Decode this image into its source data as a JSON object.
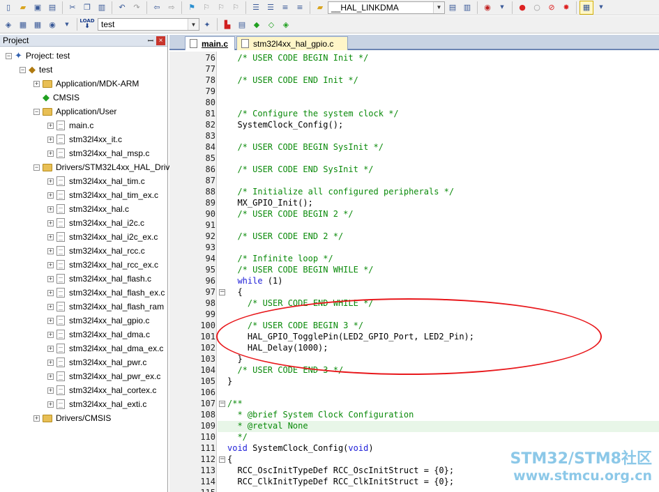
{
  "toolbar1": {
    "target_combo": "__HAL_LINKDMA"
  },
  "toolbar2": {
    "load_label": "LOAD",
    "target_select": "test"
  },
  "project_panel": {
    "title": "Project",
    "pin": "ꟷ",
    "close": "×",
    "tree": [
      {
        "label": "Project: test",
        "depth": 0,
        "kind": "project",
        "expander": "−"
      },
      {
        "label": "test",
        "depth": 1,
        "kind": "target",
        "expander": "−"
      },
      {
        "label": "Application/MDK-ARM",
        "depth": 2,
        "kind": "folder",
        "expander": "+"
      },
      {
        "label": "CMSIS",
        "depth": 2,
        "kind": "gem",
        "expander": ""
      },
      {
        "label": "Application/User",
        "depth": 2,
        "kind": "folder",
        "expander": "−"
      },
      {
        "label": "main.c",
        "depth": 3,
        "kind": "file",
        "expander": "+"
      },
      {
        "label": "stm32l4xx_it.c",
        "depth": 3,
        "kind": "file",
        "expander": "+"
      },
      {
        "label": "stm32l4xx_hal_msp.c",
        "depth": 3,
        "kind": "file",
        "expander": "+"
      },
      {
        "label": "Drivers/STM32L4xx_HAL_Driv",
        "depth": 2,
        "kind": "folder",
        "expander": "−"
      },
      {
        "label": "stm32l4xx_hal_tim.c",
        "depth": 3,
        "kind": "file",
        "expander": "+"
      },
      {
        "label": "stm32l4xx_hal_tim_ex.c",
        "depth": 3,
        "kind": "file",
        "expander": "+"
      },
      {
        "label": "stm32l4xx_hal.c",
        "depth": 3,
        "kind": "file",
        "expander": "+"
      },
      {
        "label": "stm32l4xx_hal_i2c.c",
        "depth": 3,
        "kind": "file",
        "expander": "+"
      },
      {
        "label": "stm32l4xx_hal_i2c_ex.c",
        "depth": 3,
        "kind": "file",
        "expander": "+"
      },
      {
        "label": "stm32l4xx_hal_rcc.c",
        "depth": 3,
        "kind": "file",
        "expander": "+"
      },
      {
        "label": "stm32l4xx_hal_rcc_ex.c",
        "depth": 3,
        "kind": "file",
        "expander": "+"
      },
      {
        "label": "stm32l4xx_hal_flash.c",
        "depth": 3,
        "kind": "file",
        "expander": "+"
      },
      {
        "label": "stm32l4xx_hal_flash_ex.c",
        "depth": 3,
        "kind": "file",
        "expander": "+"
      },
      {
        "label": "stm32l4xx_hal_flash_ram",
        "depth": 3,
        "kind": "file",
        "expander": "+"
      },
      {
        "label": "stm32l4xx_hal_gpio.c",
        "depth": 3,
        "kind": "file",
        "expander": "+"
      },
      {
        "label": "stm32l4xx_hal_dma.c",
        "depth": 3,
        "kind": "file",
        "expander": "+"
      },
      {
        "label": "stm32l4xx_hal_dma_ex.c",
        "depth": 3,
        "kind": "file",
        "expander": "+"
      },
      {
        "label": "stm32l4xx_hal_pwr.c",
        "depth": 3,
        "kind": "file",
        "expander": "+"
      },
      {
        "label": "stm32l4xx_hal_pwr_ex.c",
        "depth": 3,
        "kind": "file",
        "expander": "+"
      },
      {
        "label": "stm32l4xx_hal_cortex.c",
        "depth": 3,
        "kind": "file",
        "expander": "+"
      },
      {
        "label": "stm32l4xx_hal_exti.c",
        "depth": 3,
        "kind": "file",
        "expander": "+"
      },
      {
        "label": "Drivers/CMSIS",
        "depth": 2,
        "kind": "folder",
        "expander": "+"
      }
    ]
  },
  "tabs": [
    {
      "label": "main.c",
      "active": true
    },
    {
      "label": "stm32l4xx_hal_gpio.c",
      "active": false
    }
  ],
  "editor": {
    "highlighted_line": 109,
    "lines": [
      {
        "n": "76",
        "fold": "",
        "parts": [
          {
            "t": "  /* USER CODE BEGIN Init */",
            "c": "comment"
          }
        ]
      },
      {
        "n": "77",
        "fold": "",
        "parts": []
      },
      {
        "n": "78",
        "fold": "",
        "parts": [
          {
            "t": "  /* USER CODE END Init */",
            "c": "comment"
          }
        ]
      },
      {
        "n": "79",
        "fold": "",
        "parts": []
      },
      {
        "n": "80",
        "fold": "",
        "parts": []
      },
      {
        "n": "81",
        "fold": "",
        "parts": [
          {
            "t": "  /* Configure the system clock */",
            "c": "comment"
          }
        ]
      },
      {
        "n": "82",
        "fold": "",
        "parts": [
          {
            "t": "  SystemClock_Config();",
            "c": "code"
          }
        ]
      },
      {
        "n": "83",
        "fold": "",
        "parts": []
      },
      {
        "n": "84",
        "fold": "",
        "parts": [
          {
            "t": "  /* USER CODE BEGIN SysInit */",
            "c": "comment"
          }
        ]
      },
      {
        "n": "85",
        "fold": "",
        "parts": []
      },
      {
        "n": "86",
        "fold": "",
        "parts": [
          {
            "t": "  /* USER CODE END SysInit */",
            "c": "comment"
          }
        ]
      },
      {
        "n": "87",
        "fold": "",
        "parts": []
      },
      {
        "n": "88",
        "fold": "",
        "parts": [
          {
            "t": "  /* Initialize all configured peripherals */",
            "c": "comment"
          }
        ]
      },
      {
        "n": "89",
        "fold": "",
        "parts": [
          {
            "t": "  MX_GPIO_Init();",
            "c": "code"
          }
        ]
      },
      {
        "n": "90",
        "fold": "",
        "parts": [
          {
            "t": "  /* USER CODE BEGIN 2 */",
            "c": "comment"
          }
        ]
      },
      {
        "n": "91",
        "fold": "",
        "parts": []
      },
      {
        "n": "92",
        "fold": "",
        "parts": [
          {
            "t": "  /* USER CODE END 2 */",
            "c": "comment"
          }
        ]
      },
      {
        "n": "93",
        "fold": "",
        "parts": []
      },
      {
        "n": "94",
        "fold": "",
        "parts": [
          {
            "t": "  /* Infinite loop */",
            "c": "comment"
          }
        ]
      },
      {
        "n": "95",
        "fold": "",
        "parts": [
          {
            "t": "  /* USER CODE BEGIN WHILE */",
            "c": "comment"
          }
        ]
      },
      {
        "n": "96",
        "fold": "",
        "parts": [
          {
            "t": "  while",
            "c": "kw"
          },
          {
            "t": " (1)",
            "c": "code"
          }
        ]
      },
      {
        "n": "97",
        "fold": "−",
        "parts": [
          {
            "t": "  {",
            "c": "code"
          }
        ]
      },
      {
        "n": "98",
        "fold": "",
        "parts": [
          {
            "t": "    /* USER CODE END WHILE */",
            "c": "comment"
          }
        ]
      },
      {
        "n": "99",
        "fold": "",
        "parts": []
      },
      {
        "n": "100",
        "fold": "",
        "parts": [
          {
            "t": "    /* USER CODE BEGIN 3 */",
            "c": "comment"
          }
        ]
      },
      {
        "n": "101",
        "fold": "",
        "parts": [
          {
            "t": "    HAL_GPIO_TogglePin(LED2_GPIO_Port, LED2_Pin);",
            "c": "code"
          }
        ]
      },
      {
        "n": "102",
        "fold": "",
        "parts": [
          {
            "t": "    HAL_Delay(1000);",
            "c": "code"
          }
        ]
      },
      {
        "n": "103",
        "fold": "",
        "parts": [
          {
            "t": "  }",
            "c": "code"
          }
        ]
      },
      {
        "n": "104",
        "fold": "",
        "parts": [
          {
            "t": "  /* USER CODE END 3 */",
            "c": "comment"
          }
        ]
      },
      {
        "n": "105",
        "fold": "",
        "parts": [
          {
            "t": "}",
            "c": "code"
          }
        ]
      },
      {
        "n": "106",
        "fold": "",
        "parts": []
      },
      {
        "n": "107",
        "fold": "−",
        "parts": [
          {
            "t": "/**",
            "c": "doc"
          }
        ]
      },
      {
        "n": "108",
        "fold": "",
        "parts": [
          {
            "t": "  * @brief System Clock Configuration",
            "c": "doc"
          }
        ]
      },
      {
        "n": "109",
        "fold": "",
        "parts": [
          {
            "t": "  * @retval None",
            "c": "doc"
          }
        ]
      },
      {
        "n": "110",
        "fold": "",
        "parts": [
          {
            "t": "  */",
            "c": "doc"
          }
        ]
      },
      {
        "n": "111",
        "fold": "",
        "parts": [
          {
            "t": "void",
            "c": "kw"
          },
          {
            "t": " SystemClock_Config(",
            "c": "code"
          },
          {
            "t": "void",
            "c": "kw"
          },
          {
            "t": ")",
            "c": "code"
          }
        ]
      },
      {
        "n": "112",
        "fold": "−",
        "parts": [
          {
            "t": "{",
            "c": "code"
          }
        ]
      },
      {
        "n": "113",
        "fold": "",
        "parts": [
          {
            "t": "  RCC_OscInitTypeDef RCC_OscInitStruct = {0};",
            "c": "code"
          }
        ]
      },
      {
        "n": "114",
        "fold": "",
        "parts": [
          {
            "t": "  RCC_ClkInitTypeDef RCC_ClkInitStruct = {0};",
            "c": "code"
          }
        ]
      },
      {
        "n": "115",
        "fold": "",
        "parts": []
      }
    ]
  },
  "watermark": {
    "line1": "STM32/STM8社区",
    "line2": "www.stmcu.org.cn"
  }
}
